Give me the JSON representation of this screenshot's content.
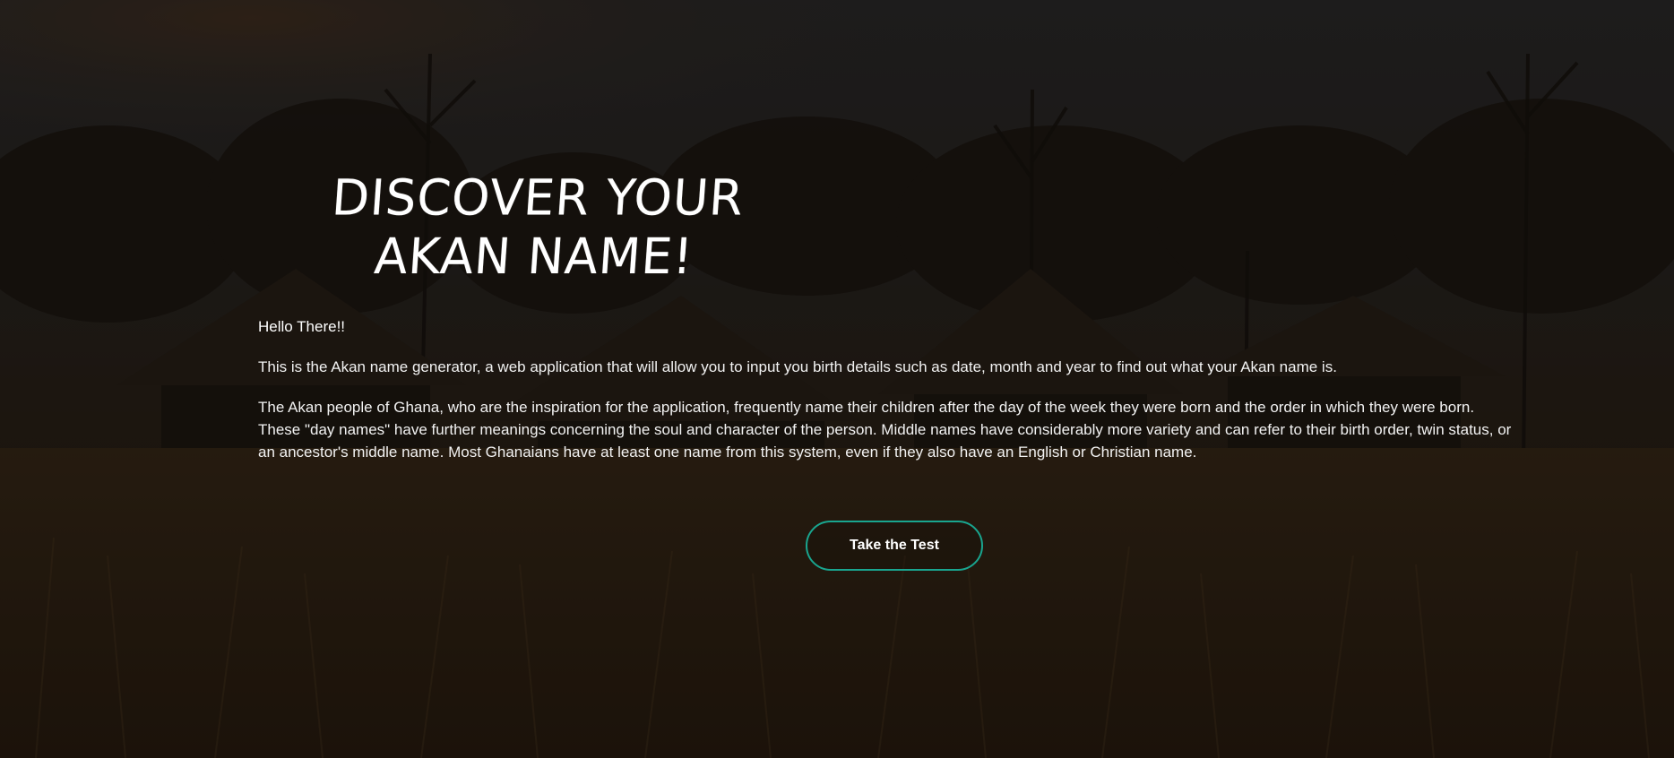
{
  "hero": {
    "title": "Discover Your Akan Name!",
    "greeting": "Hello There!!",
    "intro": "This is the Akan name generator, a web application that will allow you to input you birth details such as date, month and year to find out what your Akan name is.",
    "paragraph_1": "The Akan people of Ghana, who are the inspiration for the application, frequently name their children after the day of the week they were born and the order in which they were born.",
    "paragraph_2": "These \"day names\" have further meanings concerning the soul and character of the person. Middle names have considerably more variety and can refer to their birth order, twin status, or an ancestor's middle name. Most Ghanaians have at least one name from this system, even if they also have an English or Christian name.",
    "cta_label": "Take the Test"
  },
  "colors": {
    "button_border": "#19a58f",
    "text": "#ffffff",
    "overlay": "rgba(0,0,0,0.35)"
  }
}
